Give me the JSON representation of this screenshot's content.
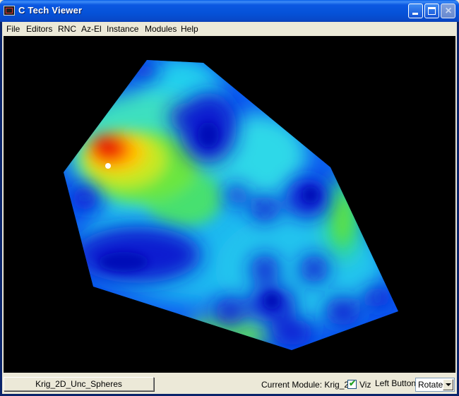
{
  "window": {
    "title": "C Tech Viewer",
    "minimize_label": "_",
    "maximize_label": "□",
    "close_label": "×"
  },
  "menu": {
    "items": [
      "File",
      "Editors",
      "RNC",
      "Az-El",
      "Instance",
      "Modules",
      "Help"
    ]
  },
  "viewport": {
    "background": "#000000",
    "colormap": [
      "#0000ff",
      "#00ffff",
      "#00ff00",
      "#ffff00",
      "#ff0000"
    ],
    "marker_color": "#ffffff"
  },
  "statusbar": {
    "module_button": "Krig_2D_Unc_Spheres",
    "current_module": "Current Module: Krig_2D",
    "viz_checked": true,
    "viz_label": "Viz",
    "left_button_label": "Left Button",
    "left_button_mode": "Rotate"
  }
}
